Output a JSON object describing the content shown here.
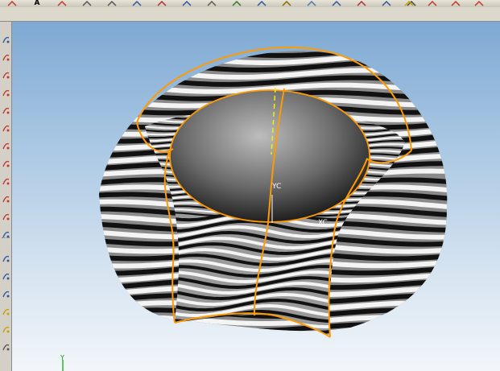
{
  "window": {
    "background": "#d4d0c8"
  },
  "toolbar": {
    "buttons": [
      {
        "icon": "sketch-icon",
        "label": ""
      },
      {
        "icon": "text-tool-icon",
        "label": "A"
      },
      {
        "icon": "point-icon",
        "label": ""
      },
      {
        "icon": "move-icon",
        "label": ""
      },
      {
        "icon": "rotate-icon",
        "label": ""
      },
      {
        "icon": "box-icon",
        "label": ""
      },
      {
        "icon": "extrude-icon",
        "label": ""
      },
      {
        "icon": "revolve-icon",
        "label": ""
      },
      {
        "icon": "sphere-icon",
        "label": ""
      },
      {
        "icon": "blend-icon",
        "label": ""
      },
      {
        "icon": "zoom-icon",
        "label": ""
      },
      {
        "icon": "pan-icon",
        "label": ""
      },
      {
        "icon": "shade-icon",
        "label": ""
      },
      {
        "icon": "view-icon",
        "label": ""
      },
      {
        "icon": "analysis-icon",
        "label": ""
      },
      {
        "icon": "layer-icon",
        "label": ""
      },
      {
        "icon": "dropdown-icon",
        "label": ""
      },
      {
        "icon": "select-icon",
        "label": ""
      },
      {
        "icon": "curve-icon",
        "label": ""
      },
      {
        "icon": "surface-icon",
        "label": ""
      },
      {
        "icon": "trim-icon",
        "label": ""
      }
    ]
  },
  "side_toolbar": {
    "buttons": [
      {
        "icon": "new-sketch-icon"
      },
      {
        "icon": "line-icon"
      },
      {
        "icon": "arc-icon"
      },
      {
        "icon": "circle-icon"
      },
      {
        "icon": "spline-icon"
      },
      {
        "icon": "fillet-icon"
      },
      {
        "icon": "chamfer-icon"
      },
      {
        "icon": "offset-curve-icon"
      },
      {
        "icon": "mirror-icon"
      },
      {
        "icon": "extend-icon"
      },
      {
        "icon": "through-curves-icon"
      },
      {
        "icon": "bounded-plane-icon"
      },
      {
        "icon": "n-sided-surface-icon"
      },
      {
        "icon": "sew-icon"
      },
      {
        "icon": "thicken-icon"
      },
      {
        "icon": "section-icon"
      },
      {
        "icon": "reflection-icon"
      },
      {
        "icon": "measure-icon"
      }
    ]
  },
  "viewport": {
    "wcs_label": "YC",
    "wcs_x_label": "XC",
    "absolute_axis_label": "Y",
    "colors": {
      "sky_top": "#7ea9d3",
      "sky_bottom": "#f2f6fa",
      "edge_highlight": "#ff9a00",
      "yaxis": "#f0f000",
      "axis_green": "#00a000"
    },
    "analysis": "reflection-zebra-stripes"
  }
}
